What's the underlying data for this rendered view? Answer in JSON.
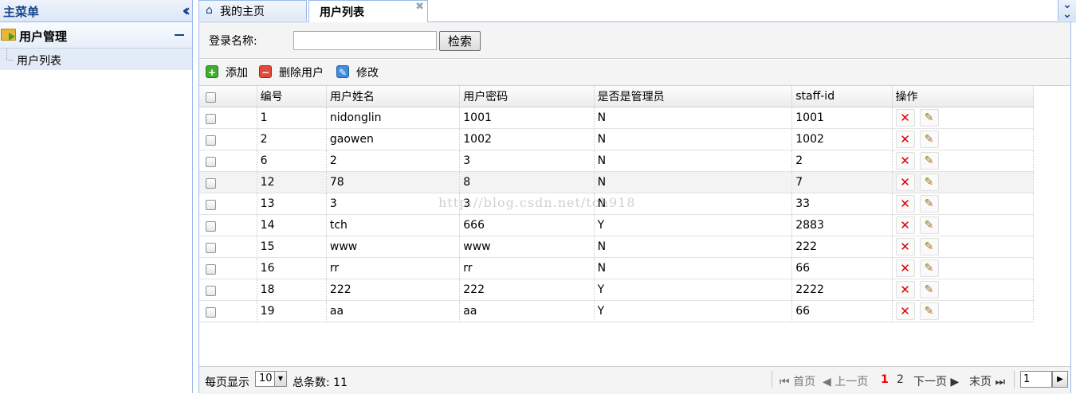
{
  "sidebar": {
    "title": "主菜单",
    "group_label": "用户管理",
    "items": [
      {
        "label": "用户列表"
      }
    ]
  },
  "tabs": [
    {
      "label": "我的主页",
      "active": false
    },
    {
      "label": "用户列表",
      "active": true
    }
  ],
  "search": {
    "label": "登录名称:",
    "value": "",
    "button_label": "检索"
  },
  "toolbar": {
    "add_label": "添加",
    "delete_label": "删除用户",
    "edit_label": "修改"
  },
  "table": {
    "columns": [
      "编号",
      "用户姓名",
      "用户密码",
      "是否是管理员",
      "staff-id",
      "操作"
    ],
    "rows": [
      [
        "1",
        "nidonglin",
        "1001",
        "N",
        "1001"
      ],
      [
        "2",
        "gaowen",
        "1002",
        "N",
        "1002"
      ],
      [
        "6",
        "2",
        "3",
        "N",
        "2"
      ],
      [
        "12",
        "78",
        "8",
        "N",
        "7"
      ],
      [
        "13",
        "3",
        "3",
        "N",
        "33"
      ],
      [
        "14",
        "tch",
        "666",
        "Y",
        "2883"
      ],
      [
        "15",
        "www",
        "www",
        "N",
        "222"
      ],
      [
        "16",
        "rr",
        "rr",
        "N",
        "66"
      ],
      [
        "18",
        "222",
        "222",
        "Y",
        "2222"
      ],
      [
        "19",
        "aa",
        "aa",
        "Y",
        "66"
      ]
    ],
    "highlighted_row_index": 3
  },
  "pager": {
    "per_page_label": "每页显示",
    "page_size": "10",
    "total_label": "总条数: 11",
    "first_label": "首页",
    "prev_label": "上一页",
    "pages": [
      "1",
      "2"
    ],
    "current_page": "1",
    "next_label": "下一页",
    "last_label": "末页",
    "jump_value": "1"
  },
  "watermark": "http://blog.csdn.net/tch918",
  "colors": {
    "border_blue": "#99bbe8",
    "title_blue": "#15428b",
    "delete_red": "#d80000",
    "current_page_red": "#e00000"
  }
}
